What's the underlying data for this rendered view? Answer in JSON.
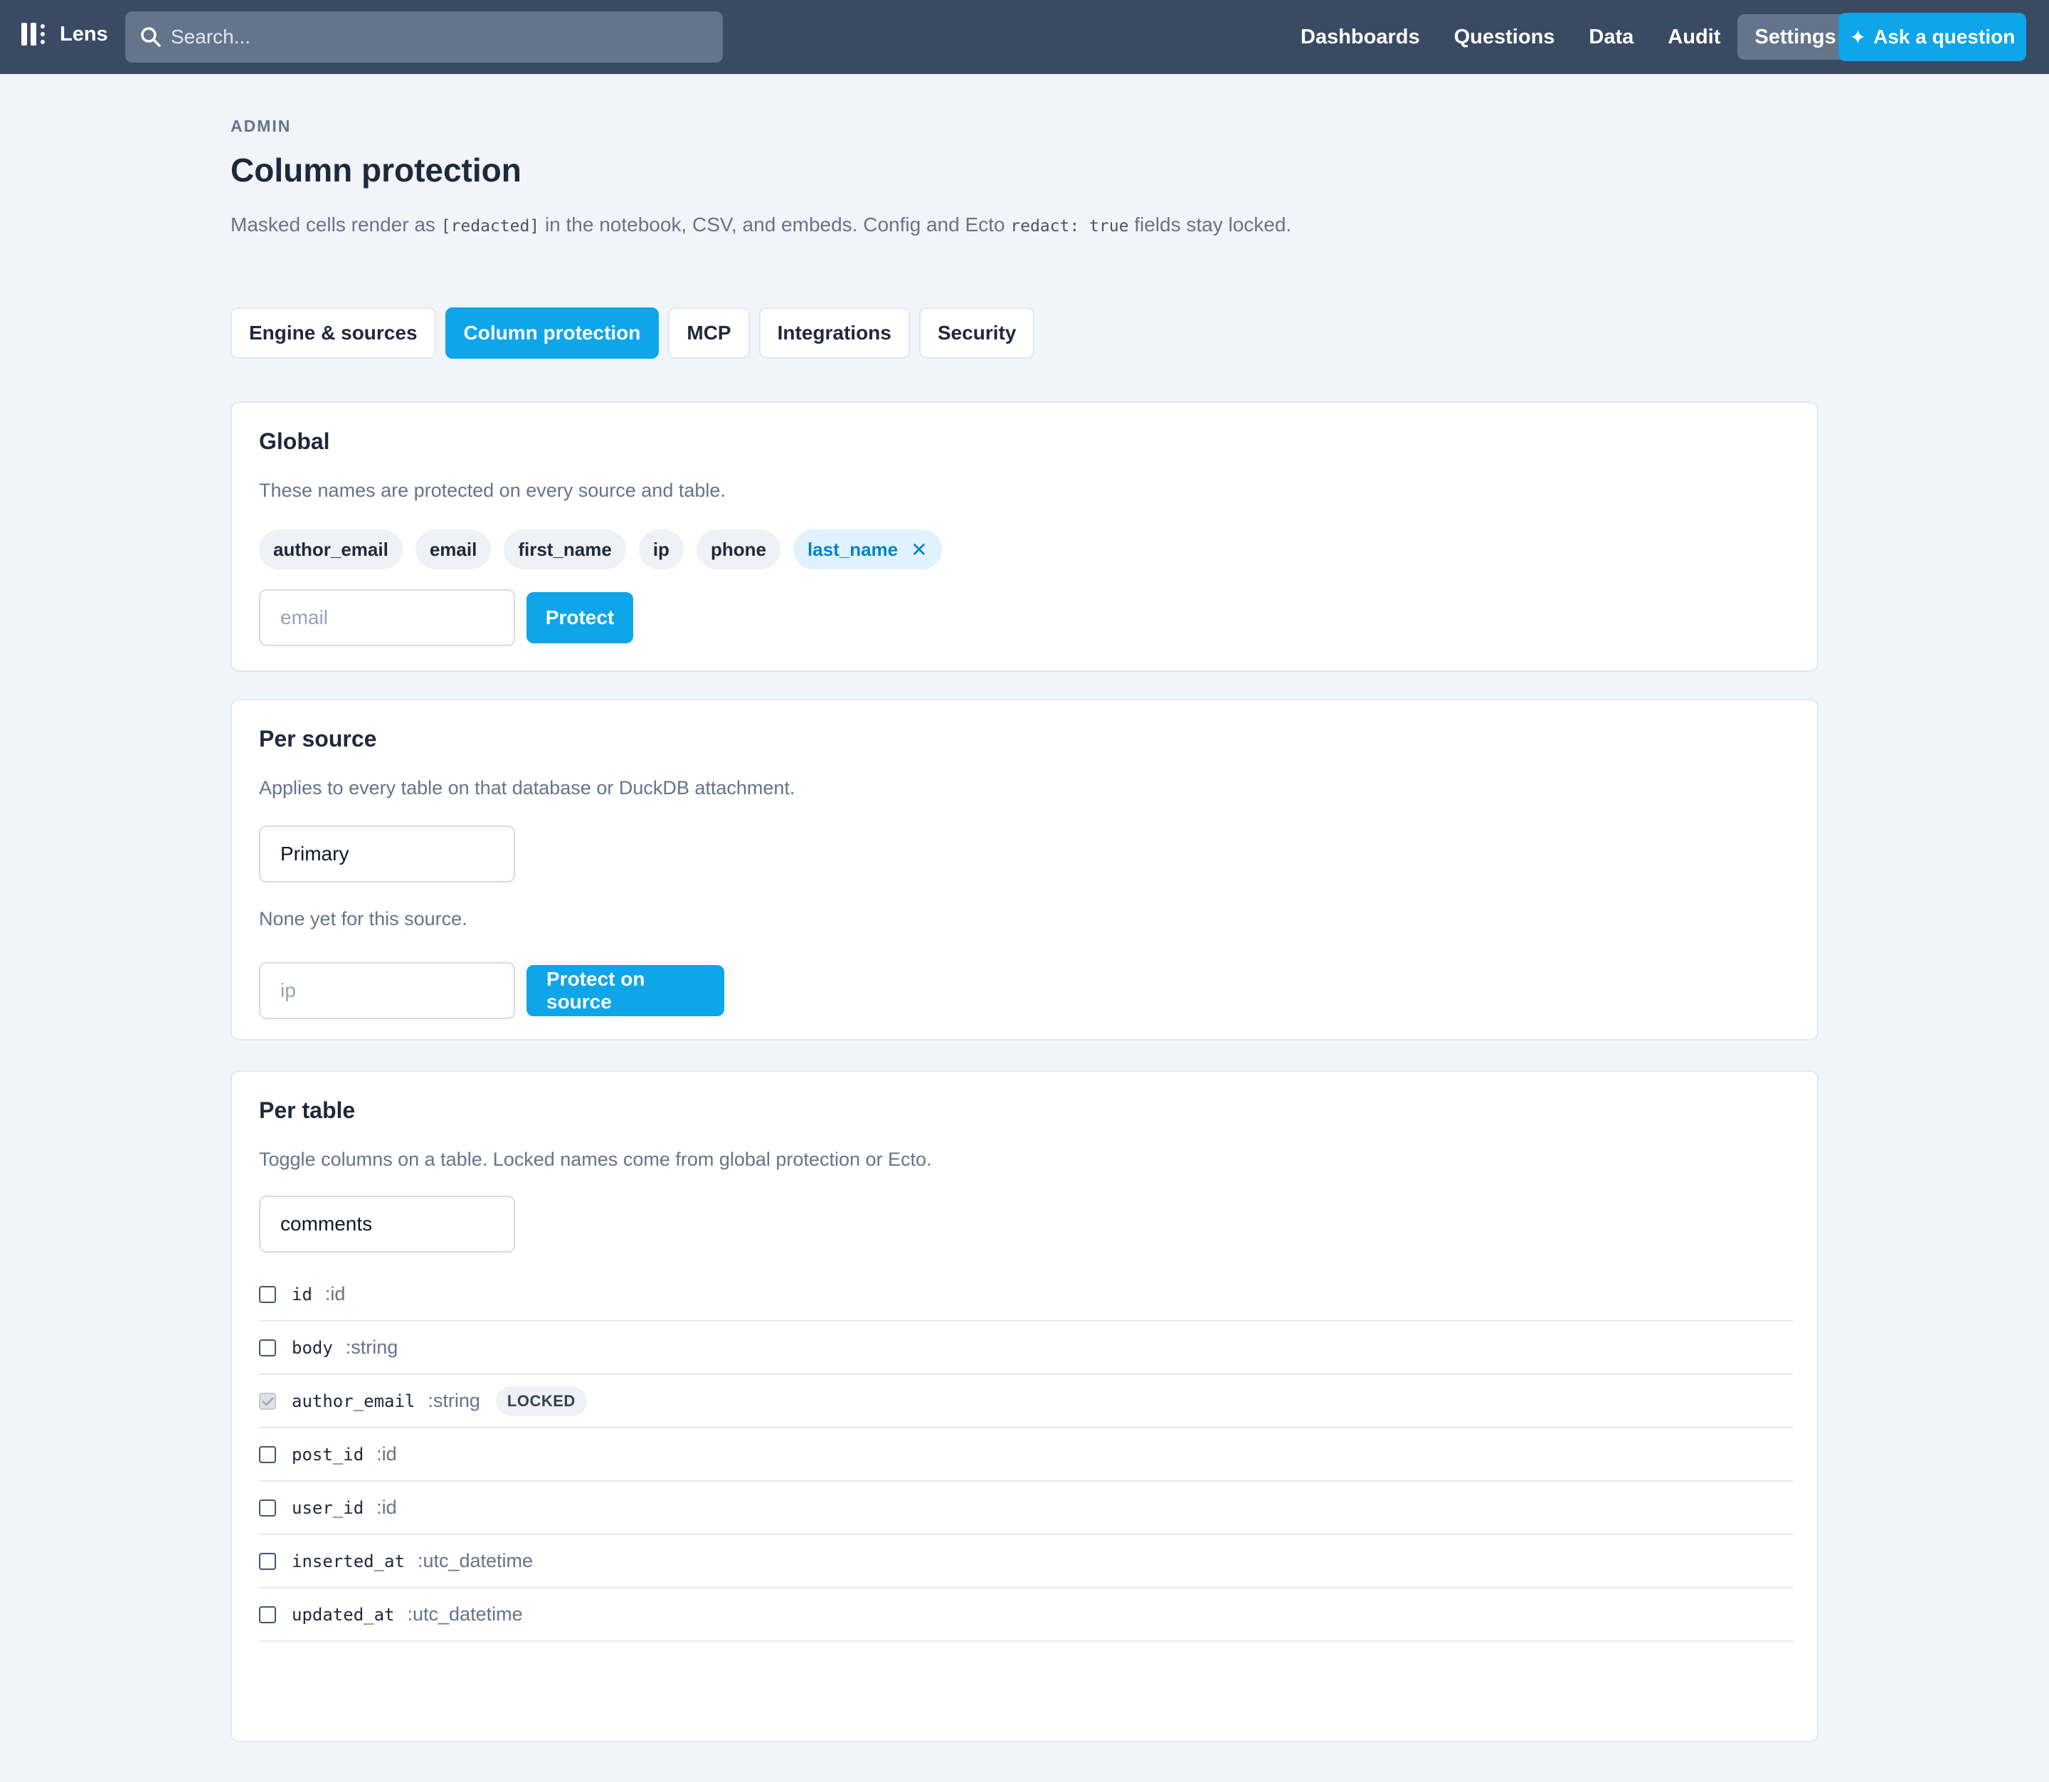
{
  "app": {
    "name": "Lens"
  },
  "search": {
    "placeholder": "Search..."
  },
  "nav": {
    "items": [
      "Dashboards",
      "Questions",
      "Data",
      "Audit",
      "Settings"
    ],
    "active": "Settings",
    "ask_label": "Ask a question"
  },
  "header": {
    "eyebrow": "ADMIN",
    "title": "Column protection",
    "subtitle_parts": [
      "Masked cells render as ",
      "[redacted]",
      " in the notebook, CSV, and embeds. Config and Ecto ",
      "redact: true",
      " fields stay locked."
    ]
  },
  "tabs": [
    "Engine & sources",
    "Column protection",
    "MCP",
    "Integrations",
    "Security"
  ],
  "active_tab": "Column protection",
  "global": {
    "title": "Global",
    "desc": "These names are protected on every source and table.",
    "chips": [
      "author_email",
      "email",
      "first_name",
      "ip",
      "phone",
      "last_name"
    ],
    "selected_chip": "last_name",
    "input_placeholder": "email",
    "button": "Protect"
  },
  "per_source": {
    "title": "Per source",
    "desc": "Applies to every table on that database or DuckDB attachment.",
    "source_value": "Primary",
    "empty": "None yet for this source.",
    "input_placeholder": "ip",
    "button": "Protect on source"
  },
  "per_table": {
    "title": "Per table",
    "desc": "Toggle columns on a table. Locked names come from global protection or Ecto.",
    "table_value": "comments",
    "columns": [
      {
        "name": "id",
        "type": ":id",
        "checked": false,
        "locked": false
      },
      {
        "name": "body",
        "type": ":string",
        "checked": false,
        "locked": false
      },
      {
        "name": "author_email",
        "type": ":string",
        "checked": true,
        "locked": true,
        "badge": "LOCKED"
      },
      {
        "name": "post_id",
        "type": ":id",
        "checked": false,
        "locked": false
      },
      {
        "name": "user_id",
        "type": ":id",
        "checked": false,
        "locked": false
      },
      {
        "name": "inserted_at",
        "type": ":utc_datetime",
        "checked": false,
        "locked": false
      },
      {
        "name": "updated_at",
        "type": ":utc_datetime",
        "checked": false,
        "locked": false
      }
    ]
  },
  "colors": {
    "accent": "#0ea5e9",
    "topbar": "#3b4a63",
    "background": "#f1f5f9"
  },
  "icons": {
    "search": "search-icon",
    "logo": "lens-logo-icon",
    "sparkle": "sparkle-icon",
    "remove": "close-icon"
  }
}
